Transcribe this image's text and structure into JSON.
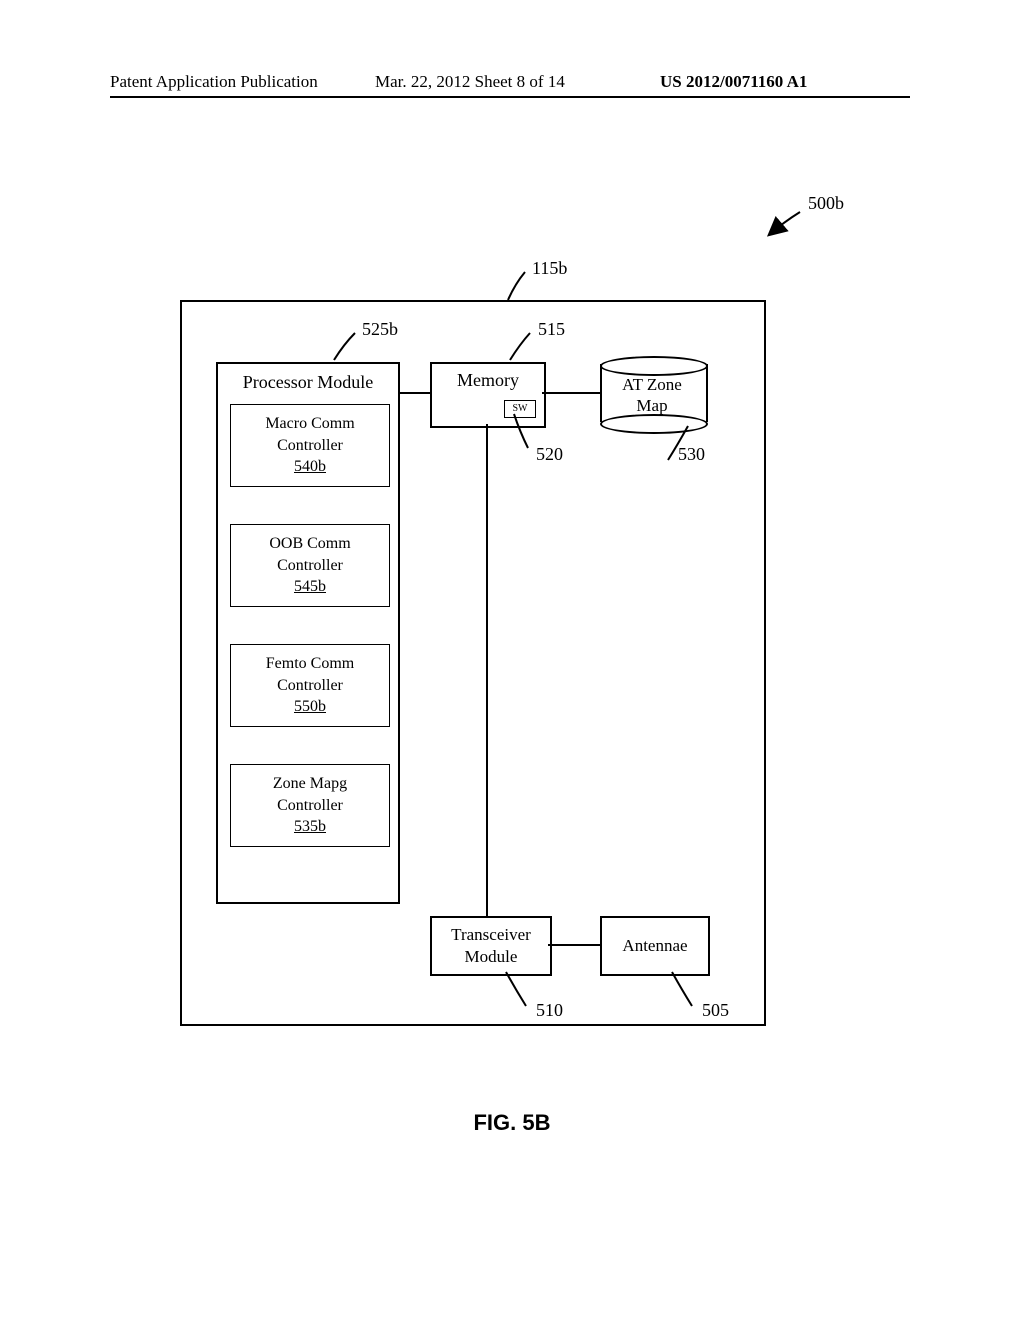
{
  "header": {
    "left": "Patent Application Publication",
    "center": "Mar. 22, 2012  Sheet 8 of 14",
    "right": "US 2012/0071160 A1"
  },
  "figure_caption": "FIG. 5B",
  "refs": {
    "system": "500b",
    "main": "115b",
    "processor": "525b",
    "memory": "515",
    "sw": "520",
    "zonemap": "530",
    "transceiver": "510",
    "antennae": "505"
  },
  "processor": {
    "title": "Processor Module",
    "blocks": [
      {
        "l1": "Macro Comm",
        "l2": "Controller",
        "ref": "540b"
      },
      {
        "l1": "OOB Comm",
        "l2": "Controller",
        "ref": "545b"
      },
      {
        "l1": "Femto Comm",
        "l2": "Controller",
        "ref": "550b"
      },
      {
        "l1": "Zone Mapg",
        "l2": "Controller",
        "ref": "535b"
      }
    ]
  },
  "memory": {
    "title": "Memory",
    "sw": "SW"
  },
  "zonemap": {
    "l1": "AT Zone",
    "l2": "Map"
  },
  "transceiver": "Transceiver\nModule",
  "antennae": "Antennae"
}
